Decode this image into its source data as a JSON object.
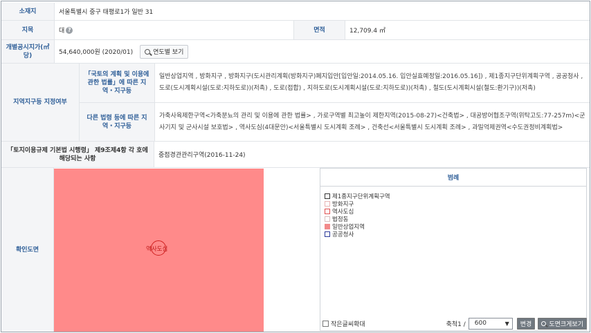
{
  "location": {
    "label": "소재지",
    "value": "서울특별시 중구 태평로1가 일반 31"
  },
  "land": {
    "label": "지목",
    "value": "대",
    "help_icon": "question-icon",
    "area_label": "면적",
    "area_value": "12,709.4 ㎡"
  },
  "price": {
    "label": "개별공시지가(㎡당)",
    "value": "54,640,000원 (2020/01)",
    "button_label": "연도별 보기",
    "button_icon": "search-icon"
  },
  "zoning": {
    "label": "지역지구등 지정여부",
    "sub1_label": "「국토의 계획 및 이용에 관한 법률」에 따른 지역・지구등",
    "sub1_value": "일반상업지역 , 방화지구 , 방화지구(도시관리계획(방화지구)폐지입안[입안일:2014.05.16. 입안실효예정일:2016.05.16]) , 제1종지구단위계획구역 , 공공청사 , 도로(도시계획시설(도로:지하도로))(저촉) , 도로(접합) , 지하도로(도시계획시설(도로:지하도로))(저촉) , 철도(도시계획시설(철도:환기구))(저촉)",
    "sub2_label": "다른 법령 등에 따른 지역・지구등",
    "sub2_value": "가축사육제한구역<가축분뇨의 관리 및 이용에 관한 법률> , 가로구역별 최고높이 제한지역(2015-08-27)<건축법> , 대공방어협조구역(위탁고도:77-257m)<군사기지 및 군사시설 보호법> , 역사도심(4대문안)<서울특별시 도시계획 조례> , 건축선<서울특별시 도시계획 조례> , 과밀억제권역<수도권정비계획법>"
  },
  "enforcement": {
    "label": "「토지이용규제 기본법 시행령」 제9조제4항 각 호에 해당되는 사항",
    "value": "중점경관관리구역(2016-11-24)"
  },
  "map": {
    "label": "확인도면",
    "marker_text": "역사도심",
    "legend_title": "범례",
    "legend": [
      {
        "label": "제1종지구단위계획구역",
        "color": "#333333",
        "style": "outline"
      },
      {
        "label": "방화지구",
        "color": "#e8b4b4",
        "style": "outline"
      },
      {
        "label": "역사도심",
        "color": "#e05050",
        "style": "outline"
      },
      {
        "label": "법정동",
        "color": "#d8c0c0",
        "style": "outline"
      },
      {
        "label": "일반상업지역",
        "color": "#f28a8a",
        "style": "fill"
      },
      {
        "label": "공공청사",
        "color": "#2a3a9a",
        "style": "outline"
      }
    ],
    "enlarge_text_label": "작은글씨확대",
    "scale_label": "축척1 /",
    "scale_value": "600",
    "change_button": "변경",
    "enlarge_button": "도면크게보기",
    "map_fill_color": "#ff8a8a"
  }
}
